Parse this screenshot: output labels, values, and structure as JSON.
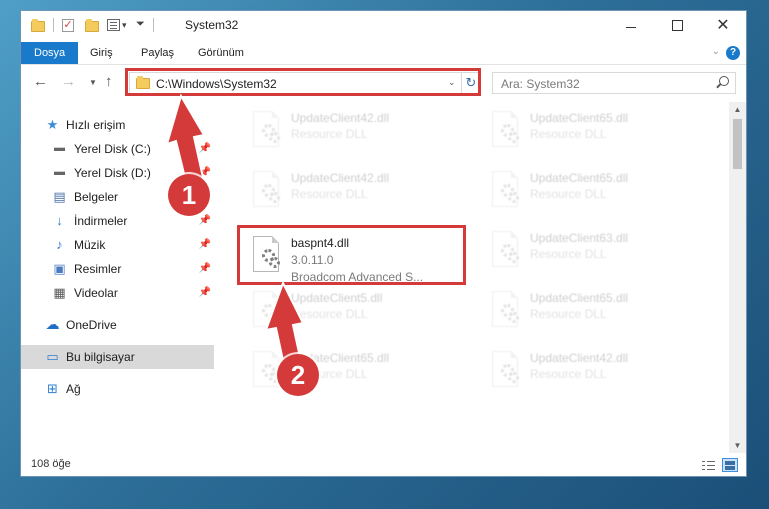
{
  "window": {
    "title": "System32",
    "controls": {
      "minimize": "minimize",
      "maximize": "maximize",
      "close": "✕"
    }
  },
  "ribbon": {
    "tabs": [
      "Dosya",
      "Giriş",
      "Paylaş",
      "Görünüm"
    ],
    "help": "?"
  },
  "nav": {
    "address": "C:\\Windows\\System32",
    "search_placeholder": "Ara: System32"
  },
  "sidebar": {
    "items": [
      {
        "label": "Hızlı erişim",
        "icon": "star-icon",
        "pinned": false
      },
      {
        "label": "Yerel Disk (C:)",
        "icon": "drive-icon",
        "pinned": true
      },
      {
        "label": "Yerel Disk (D:)",
        "icon": "drive-icon",
        "pinned": true
      },
      {
        "label": "Belgeler",
        "icon": "documents-icon",
        "pinned": true
      },
      {
        "label": "İndirmeler",
        "icon": "downloads-icon",
        "pinned": true
      },
      {
        "label": "Müzik",
        "icon": "music-icon",
        "pinned": true
      },
      {
        "label": "Resimler",
        "icon": "pictures-icon",
        "pinned": true
      },
      {
        "label": "Videolar",
        "icon": "videos-icon",
        "pinned": true
      },
      {
        "label": "OneDrive",
        "icon": "onedrive-icon",
        "pinned": false
      },
      {
        "label": "Bu bilgisayar",
        "icon": "computer-icon",
        "pinned": false,
        "selected": true
      },
      {
        "label": "Ağ",
        "icon": "network-icon",
        "pinned": false
      }
    ]
  },
  "files": [
    {
      "name": "UpdateClient42.dll",
      "line2": "Resource DLL",
      "faded": true
    },
    {
      "name": "UpdateClient65.dll",
      "line2": "Resource DLL",
      "faded": true
    },
    {
      "name": "UpdateClient42.dll",
      "line2": "Resource DLL",
      "faded": true
    },
    {
      "name": "UpdateClient65.dll",
      "line2": "Resource DLL",
      "faded": true
    },
    {
      "name": "baspnt4.dll",
      "line2": "3.0.11.0",
      "line3": "Broadcom Advanced S...",
      "faded": false,
      "highlighted": true
    },
    {
      "name": "UpdateClient63.dll",
      "line2": "Resource DLL",
      "faded": true
    },
    {
      "name": "UpdateClient5.dll",
      "line2": "Resource DLL",
      "faded": true
    },
    {
      "name": "UpdateClient65.dll",
      "line2": "Resource DLL",
      "faded": true
    },
    {
      "name": "UpdateClient65.dll",
      "line2": "Resource DLL",
      "faded": true
    },
    {
      "name": "UpdateClient42.dll",
      "line2": "Resource DLL",
      "faded": true
    }
  ],
  "status": {
    "count": "108 öğe"
  },
  "annotations": {
    "step1": "1",
    "step2": "2",
    "color": "#d43a3a"
  },
  "colors": {
    "accent": "#1979ca",
    "selection": "#d9d9d9",
    "annotation": "#d43a3a"
  }
}
